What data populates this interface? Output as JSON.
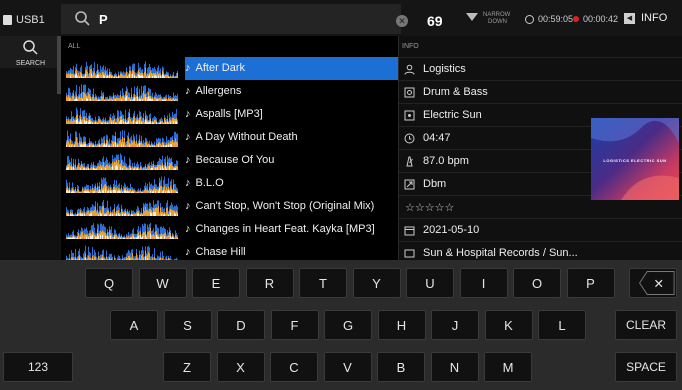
{
  "topbar": {
    "device": "USB1",
    "search_query": "P",
    "result_count": "69",
    "narrow_line1": "NARROW",
    "narrow_line2": "DOWN",
    "time_elapsed": "00:59:05",
    "rec_time": "00:00:42",
    "info_label": "INFO"
  },
  "sidenav": {
    "search_label": "SEARCH"
  },
  "list": {
    "header": "ALL",
    "tracks": [
      {
        "title": "After Dark",
        "selected": true
      },
      {
        "title": "Allergens",
        "selected": false
      },
      {
        "title": "Aspalls [MP3]",
        "selected": false
      },
      {
        "title": "A Day Without Death",
        "selected": false
      },
      {
        "title": "Because Of You",
        "selected": false
      },
      {
        "title": "B.L.O",
        "selected": false
      },
      {
        "title": "Can't Stop, Won't Stop (Original Mix)",
        "selected": false
      },
      {
        "title": "Changes in Heart Feat. Kayka [MP3]",
        "selected": false
      },
      {
        "title": "Chase Hill",
        "selected": false
      }
    ]
  },
  "info": {
    "header": "INFO",
    "artist": "Logistics",
    "genre": "Drum & Bass",
    "album": "Electric Sun",
    "duration": "04:47",
    "bpm": "87.0 bpm",
    "key": "Dbm",
    "rating": "☆☆☆☆☆",
    "date": "2021-05-10",
    "label": "Sun & Hospital Records / Sun...",
    "art_text": "LOGISTICS  ELECTRIC SUN"
  },
  "keyboard": {
    "row1": [
      "Q",
      "W",
      "E",
      "R",
      "T",
      "Y",
      "U",
      "I",
      "O",
      "P"
    ],
    "row2": [
      "A",
      "S",
      "D",
      "F",
      "G",
      "H",
      "J",
      "K",
      "L"
    ],
    "row3": [
      "Z",
      "X",
      "C",
      "V",
      "B",
      "N",
      "M"
    ],
    "backspace_symbol": "✕",
    "clear_label": "CLEAR",
    "numbers_label": "123",
    "space_label": "SPACE"
  },
  "colors": {
    "selection": "#1c6fd4",
    "rec_dot": "#e02020",
    "wave_blue": "#2a6fd6",
    "wave_orange": "#e8a23a"
  }
}
